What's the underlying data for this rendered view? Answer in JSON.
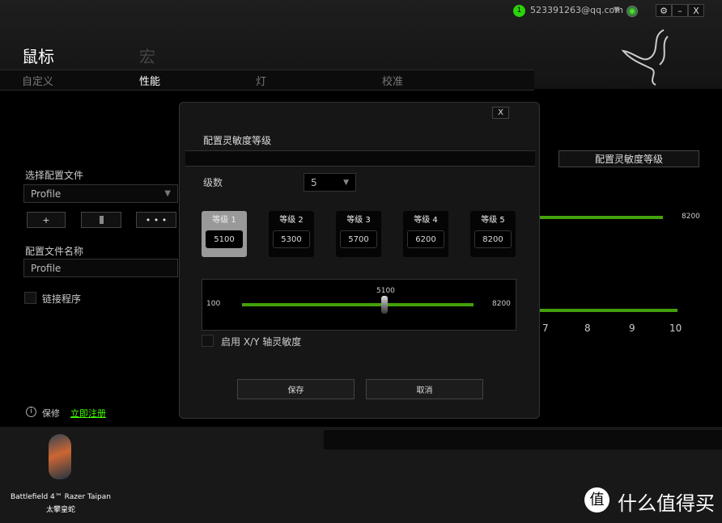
{
  "header": {
    "user_badge": "1",
    "email": "523391263@qq.com",
    "settings_icon": "gear-icon",
    "min_label": "–",
    "close_label": "X"
  },
  "main_tabs": [
    {
      "label": "鼠标",
      "active": true
    },
    {
      "label": "宏",
      "active": false
    }
  ],
  "sub_tabs": [
    {
      "label": "自定义"
    },
    {
      "label": "性能",
      "active": true
    },
    {
      "label": "灯"
    },
    {
      "label": "校准"
    }
  ],
  "left": {
    "select_profile_label": "选择配置文件",
    "profile_select": "Profile",
    "add": "+",
    "more": "• • •",
    "profile_name_label": "配置文件名称",
    "profile_name": "Profile",
    "link_program": "链接程序",
    "warranty": "保修",
    "register": "立即注册"
  },
  "right": {
    "sens_button": "配置灵敏度等级",
    "top_value": "8200",
    "ticks": [
      "7",
      "8",
      "9",
      "10"
    ]
  },
  "dialog": {
    "close": "X",
    "title": "配置灵敏度等级",
    "levels_label": "级数",
    "levels_value": "5",
    "levels": [
      {
        "label": "等级 1",
        "value": "5100"
      },
      {
        "label": "等级 2",
        "value": "5300"
      },
      {
        "label": "等级 3",
        "value": "5700"
      },
      {
        "label": "等级 4",
        "value": "6200"
      },
      {
        "label": "等级 5",
        "value": "8200"
      }
    ],
    "slider": {
      "min": "100",
      "max": "8200",
      "value": "5100"
    },
    "xy_label": "启用 X/Y 轴灵敏度",
    "save": "保存",
    "cancel": "取消"
  },
  "device": {
    "name": "Battlefield 4™ Razer Taipan",
    "name_cn": "太攀皇蛇"
  },
  "watermark": "什么值得买",
  "colors": {
    "accent": "#44a00a",
    "link": "#44ff00"
  }
}
